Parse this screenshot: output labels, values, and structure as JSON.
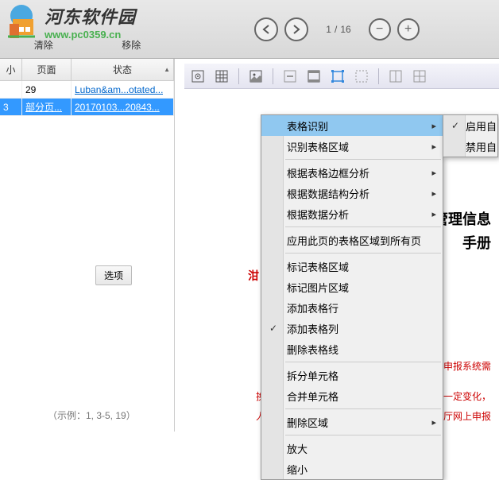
{
  "watermark": {
    "title": "河东软件园",
    "url": "www.pc0359.cn"
  },
  "topButtons": {
    "clear": "清除",
    "remove": "移除"
  },
  "nav": {
    "currentPage": "1",
    "separator": "/",
    "totalPages": "16"
  },
  "table": {
    "headers": {
      "col1": "小",
      "col2": "页面",
      "col3": "状态"
    },
    "rows": [
      {
        "c1": "",
        "c2": "29",
        "c3": "Luban&am...otated..."
      },
      {
        "c1": "3",
        "c2": "部分页...",
        "c3": "20170103...20843..."
      }
    ]
  },
  "optionsBtn": "选项",
  "exampleText": "（示例：1, 3-5, 19）",
  "doc": {
    "title1": "管理信息",
    "title2": "手册",
    "redLabel": "泔",
    "redLine1": "申报系统需",
    "redLine2a": "换",
    "redLine2b": "一定变化，",
    "redLine3a": "人",
    "redLine3b": "厅网上申报"
  },
  "contextMenu": [
    {
      "label": "表格识别",
      "hl": true,
      "sub": true
    },
    {
      "label": "识别表格区域",
      "sub": true
    },
    {
      "sep": true
    },
    {
      "label": "根据表格边框分析",
      "sub": true
    },
    {
      "label": "根据数据结构分析",
      "sub": true
    },
    {
      "label": "根据数据分析",
      "sub": true
    },
    {
      "sep": true
    },
    {
      "label": "应用此页的表格区域到所有页"
    },
    {
      "sep": true
    },
    {
      "label": "标记表格区域"
    },
    {
      "label": "标记图片区域"
    },
    {
      "label": "添加表格行"
    },
    {
      "label": "添加表格列",
      "checked": true
    },
    {
      "label": "删除表格线"
    },
    {
      "sep": true
    },
    {
      "label": "拆分单元格"
    },
    {
      "label": "合并单元格"
    },
    {
      "sep": true
    },
    {
      "label": "删除区域",
      "sub": true
    },
    {
      "sep": true
    },
    {
      "label": "放大"
    },
    {
      "label": "缩小"
    }
  ],
  "submenu": [
    {
      "label": "启用自",
      "checked": true
    },
    {
      "label": "禁用自"
    }
  ]
}
